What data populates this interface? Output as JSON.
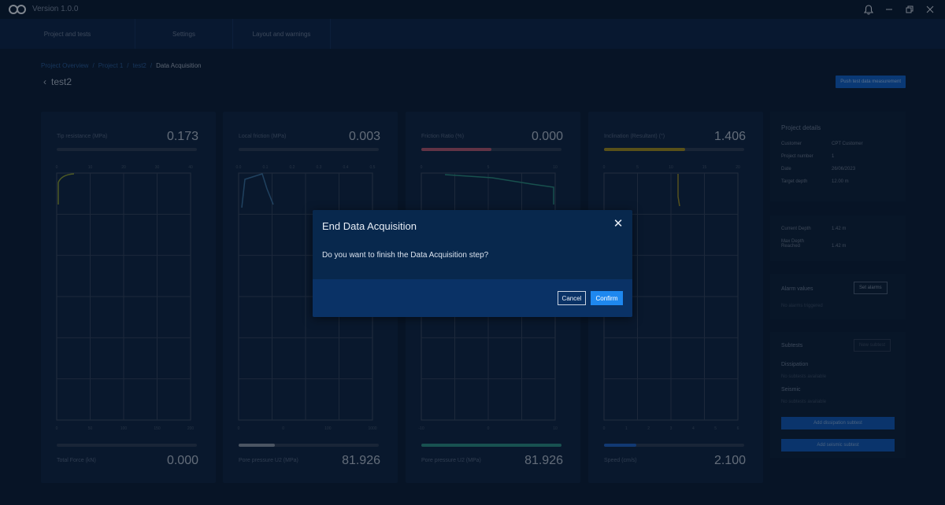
{
  "app": {
    "version": "Version 1.0.0"
  },
  "nav": {
    "tabs": [
      "Project and tests",
      "Settings",
      "Layout and warnings"
    ]
  },
  "breadcrumb": [
    "Project Overview",
    "Project 1",
    "test2",
    "Data Acquisition"
  ],
  "page": {
    "title": "test2",
    "top_action": "Push test data measurement"
  },
  "panels": [
    {
      "title": "Tip resistance (MPa)",
      "value": "0.173",
      "bottom_title": "Total Force (kN)",
      "bottom_value": "0.000",
      "top_color": "#3a4658",
      "top_fill": 0.0,
      "bottom_color": "#3a4658",
      "bottom_fill": 0.0,
      "trace_color": "#8a9a30",
      "x_ticks": [
        "0",
        "10",
        "20",
        "30",
        "40"
      ],
      "bottom_ticks": [
        "0",
        "50",
        "100",
        "150",
        "200"
      ]
    },
    {
      "title": "Local friction (MPa)",
      "value": "0.003",
      "bottom_title": "Pore pressure U2 (MPa)",
      "bottom_value": "81.926",
      "top_color": "#3a4658",
      "top_fill": 0.0,
      "bottom_color": "#8892a2",
      "bottom_fill": 0.26,
      "trace_color": "#3a6e9c",
      "x_ticks": [
        "0.0",
        "0.1",
        "0.2",
        "0.3",
        "0.4",
        "0.5"
      ],
      "bottom_ticks": [
        "0",
        "0",
        "100",
        "1000"
      ]
    },
    {
      "title": "Friction Ratio (%)",
      "value": "0.000",
      "bottom_title": "Pore pressure U2 (MPa)",
      "bottom_value": "81.926",
      "top_color": "#b0546c",
      "top_fill": 0.5,
      "bottom_color": "#2a8a80",
      "bottom_fill": 1.0,
      "trace_color": "#2a8a7c",
      "x_ticks": [
        "0",
        "5",
        "10"
      ],
      "bottom_ticks": [
        "-10",
        "0",
        "10"
      ]
    },
    {
      "title": "Inclination (Resultant) (°)",
      "value": "1.406",
      "bottom_title": "Speed (cm/s)",
      "bottom_value": "2.100",
      "top_color": "#a08a1c",
      "top_fill": 0.58,
      "bottom_color": "#1f5fc0",
      "bottom_fill": 0.23,
      "trace_color": "#9a8a26",
      "x_ticks": [
        "0",
        "5",
        "10",
        "15",
        "20"
      ],
      "bottom_ticks": [
        "0",
        "1",
        "2",
        "3",
        "4",
        "5",
        "6"
      ]
    }
  ],
  "sidebar": {
    "project_details_title": "Project details",
    "details": [
      {
        "k": "Customer",
        "v": "CPT Customer"
      },
      {
        "k": "Project number",
        "v": "1"
      },
      {
        "k": "Date",
        "v": "26/06/2023"
      },
      {
        "k": "Target depth",
        "v": "12.00 m"
      }
    ],
    "depth": [
      {
        "k": "Current Depth",
        "v": "1.42 m"
      },
      {
        "k": "Max Depth Reached",
        "v": "1.42 m"
      }
    ],
    "alarm_title": "Alarm values",
    "alarm_button": "Set alarms",
    "alarm_empty": "No alarms triggered",
    "subtests_title": "Subtests",
    "subtests_button": "New subtest",
    "dissipation_title": "Dissipation",
    "dissipation_empty": "No subtests available",
    "seismic_title": "Seismic",
    "seismic_empty": "No subtests available",
    "add_dissipation": "Add dissipation subtest",
    "add_seismic": "Add seismic subtest"
  },
  "modal": {
    "title": "End Data Acquisition",
    "message": "Do you want to finish the Data Acquisition step?",
    "cancel_label": "Cancel",
    "confirm_label": "Confirm"
  }
}
